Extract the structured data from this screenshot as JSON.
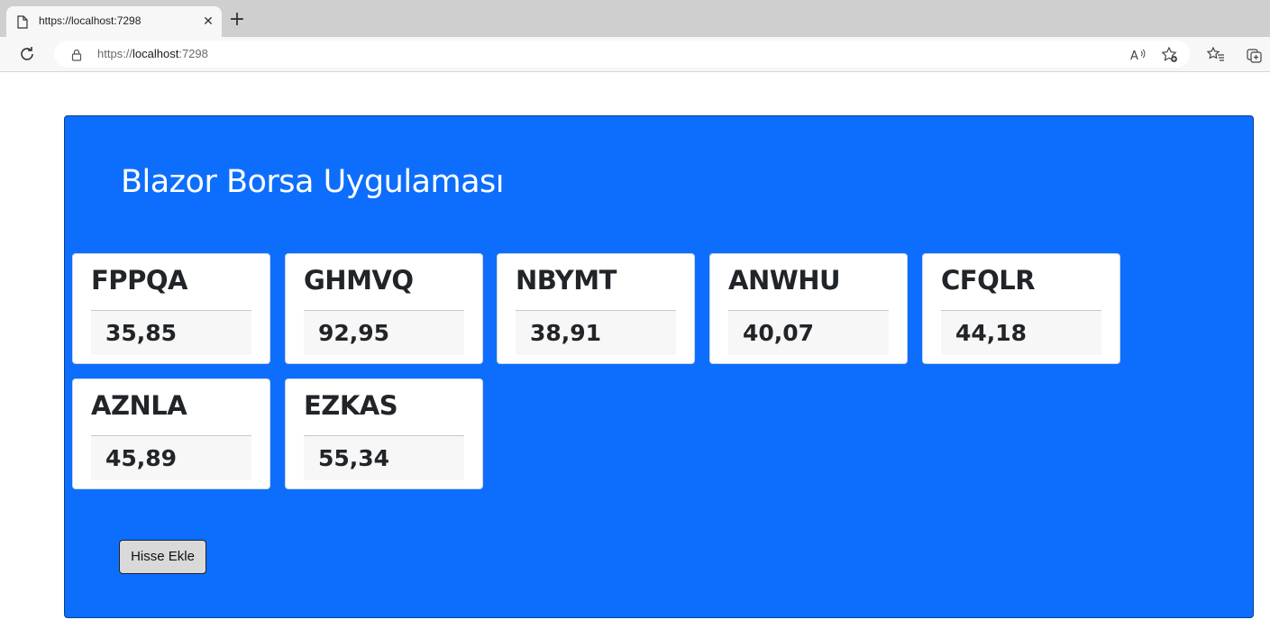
{
  "browser": {
    "tab_title": "https://localhost:7298",
    "url_prefix": "https://",
    "url_host": "localhost",
    "url_port": ":7298",
    "icons": [
      "page-icon",
      "close-icon",
      "plus-icon",
      "refresh-icon",
      "lock-icon",
      "read-aloud-icon",
      "favorite-add-icon",
      "favorites-icon",
      "collections-icon"
    ]
  },
  "app": {
    "title": "Blazor Borsa Uygulaması",
    "add_button_label": "Hisse Ekle",
    "accent_color": "#0d6efd",
    "stocks": [
      {
        "symbol": "FPPQA",
        "price": "35,85"
      },
      {
        "symbol": "GHMVQ",
        "price": "92,95"
      },
      {
        "symbol": "NBYMT",
        "price": "38,91"
      },
      {
        "symbol": "ANWHU",
        "price": "40,07"
      },
      {
        "symbol": "CFQLR",
        "price": "44,18"
      },
      {
        "symbol": "AZNLA",
        "price": "45,89"
      },
      {
        "symbol": "EZKAS",
        "price": "55,34"
      }
    ]
  }
}
